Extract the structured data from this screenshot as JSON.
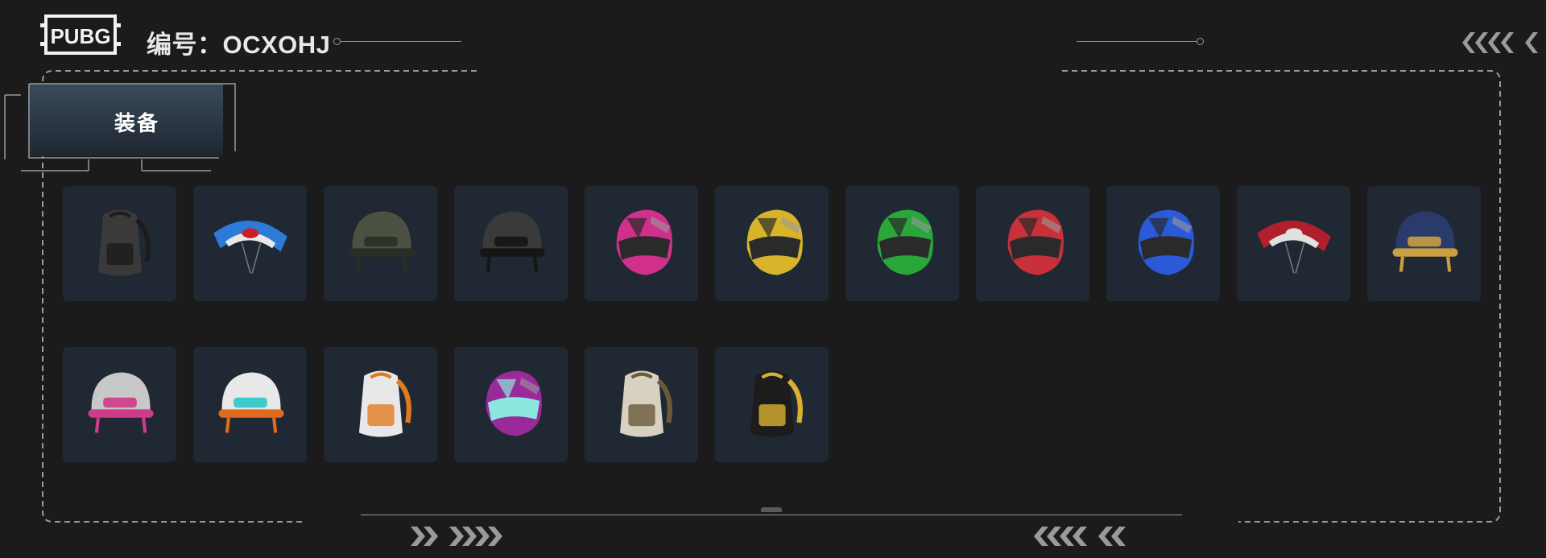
{
  "header": {
    "logo_text": "PUBG",
    "code_label": "编号：OCXOHJ"
  },
  "tabs": [
    {
      "label": "装备",
      "active": true
    }
  ],
  "items": [
    {
      "name": "black backpack",
      "icon": "backpack-icon",
      "colors": [
        "#3a3a3a",
        "#1c1c1c"
      ]
    },
    {
      "name": "bugatti parachute",
      "icon": "parachute-icon",
      "colors": [
        "#2c7bd8",
        "#e8e8e8",
        "#c8202a"
      ]
    },
    {
      "name": "military helmet with goggles",
      "icon": "helmet-icon",
      "colors": [
        "#4b5242",
        "#2a2d26"
      ]
    },
    {
      "name": "carbon open-face helmet",
      "icon": "helmet-icon",
      "colors": [
        "#3a3a3a",
        "#151515"
      ]
    },
    {
      "name": "pink racing helmet",
      "icon": "racing-helmet-icon",
      "colors": [
        "#d0308a",
        "#2a2a2a"
      ]
    },
    {
      "name": "yellow racing helmet",
      "icon": "racing-helmet-icon",
      "colors": [
        "#d8b42a",
        "#2a2a2a"
      ]
    },
    {
      "name": "green racing helmet",
      "icon": "racing-helmet-icon",
      "colors": [
        "#2aa63a",
        "#2a2a2a"
      ]
    },
    {
      "name": "red racing helmet",
      "icon": "racing-helmet-icon",
      "colors": [
        "#c8303a",
        "#2a2a2a"
      ]
    },
    {
      "name": "blue racing helmet",
      "icon": "racing-helmet-icon",
      "colors": [
        "#2a5ad8",
        "#2a2a2a"
      ]
    },
    {
      "name": "red parachute",
      "icon": "parachute-icon",
      "colors": [
        "#b0202c",
        "#e0e0e0"
      ]
    },
    {
      "name": "navy level-3 helmet",
      "icon": "helmet-icon",
      "colors": [
        "#2a3a6a",
        "#c8a040"
      ]
    },
    {
      "name": "white bear helmet",
      "icon": "helmet-icon",
      "colors": [
        "#c8c8c8",
        "#d03a8a"
      ]
    },
    {
      "name": "white orange pilot helmet",
      "icon": "helmet-icon",
      "colors": [
        "#e8e8e8",
        "#e06a20",
        "#2ac8c8"
      ]
    },
    {
      "name": "snow sports backpack",
      "icon": "backpack-icon",
      "colors": [
        "#e8e8e8",
        "#e07a20"
      ]
    },
    {
      "name": "purple cat helmet",
      "icon": "racing-helmet-icon",
      "colors": [
        "#9a2a9a",
        "#8ae8e0"
      ]
    },
    {
      "name": "map print backpack",
      "icon": "backpack-icon",
      "colors": [
        "#d8d0c0",
        "#6a5a3a"
      ]
    },
    {
      "name": "black gold backpack",
      "icon": "backpack-icon",
      "colors": [
        "#1c1c1c",
        "#d8b030"
      ]
    }
  ]
}
